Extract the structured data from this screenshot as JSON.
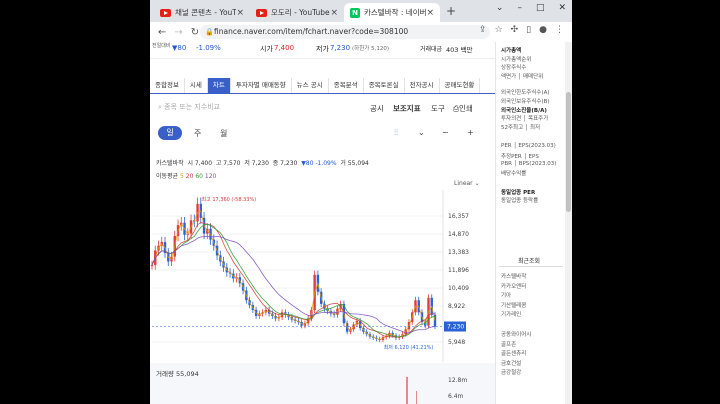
{
  "tabs": [
    {
      "title": "채널 콘텐츠 - YouTube",
      "icon": "youtube-icon"
    },
    {
      "title": "오도리 - YouTube",
      "icon": "youtube-icon"
    },
    {
      "title": "카스텔바작 : 네이버 증",
      "icon": "naver-icon"
    }
  ],
  "address": {
    "url": "finance.naver.com/item/fchart.naver?code=308100"
  },
  "price_row": {
    "prev_label": "전일대비",
    "change_amount": "▼80",
    "change_pct": "-1.09%",
    "high_label": "시가",
    "high_value": "7,400",
    "low_label": "저가",
    "low_value": "7,230",
    "low_note": "(하한가 5,120)",
    "amount_label": "거래대금",
    "amount_value": "403 백만"
  },
  "sub_tabs": [
    "종합정보",
    "시세",
    "차트",
    "투자자별 매매동향",
    "뉴스 공시",
    "종목분석",
    "종목토론실",
    "전자공시",
    "공매도현황"
  ],
  "active_sub_tab": "차트",
  "search": {
    "placeholder": "종목 또는 지수비교"
  },
  "chart_tools": {
    "notice": "공시",
    "indicator": "보조지표",
    "tool": "도구",
    "print": "인쇄"
  },
  "periods": [
    "일",
    "주",
    "월"
  ],
  "active_period": "일",
  "stock_info": {
    "name": "카스텔바작",
    "open": "시 7,400",
    "high": "고 7,570",
    "low": "저 7,230",
    "close": "종 7,230",
    "change": "▼80 -1.09%",
    "volume": "거 55,094"
  },
  "ma_label": "이동평균",
  "ma_values": [
    "5",
    "20",
    "60",
    "120"
  ],
  "scale_mode": "Linear",
  "chart_data": {
    "type": "line",
    "title": "",
    "y_ticks": [
      16357,
      14870,
      13383,
      11896,
      10409,
      8922,
      5948
    ],
    "current_price": 7230,
    "ylim": [
      4300,
      18500
    ],
    "annotations": [
      {
        "text": "최고 17,360 (-58.33%)",
        "value": 17360
      },
      {
        "text": "최저 6,120 (41.21%)",
        "value": 6120
      }
    ],
    "series": [
      {
        "name": "",
        "values": [
          12300,
          13500,
          13900,
          14200,
          13300,
          12600,
          13000,
          14700,
          15600,
          15800,
          14800,
          14900,
          16000,
          15900,
          17360,
          16200,
          14900,
          15300,
          14400,
          13900,
          13100,
          12600,
          12100,
          11700,
          11600,
          11200,
          11300,
          10800,
          10200,
          9400,
          9000,
          8600,
          8100,
          8300,
          8400,
          8600,
          8300,
          8100,
          7900,
          8000,
          8400,
          8200,
          8000,
          7800,
          7700,
          7600,
          7300,
          7500,
          7900,
          8600,
          11500,
          10100,
          9100,
          8700,
          8500,
          8300,
          8200,
          8700,
          9100,
          7500,
          6800,
          7000,
          7400,
          7700,
          7100,
          6800,
          6600,
          6400,
          6300,
          6200,
          6120,
          6350,
          6450,
          6700,
          6500,
          6300,
          6400,
          6600,
          7000,
          7600,
          8400,
          9400,
          8400,
          7600,
          7300,
          9600,
          8200,
          7230
        ]
      }
    ],
    "grid": true
  },
  "volume": {
    "label": "거래량",
    "value": "55,094",
    "y_ticks": [
      "12.8m",
      "6.4m"
    ]
  },
  "sidebar": {
    "items": [
      "시가총액",
      "시가총액순위",
      "상장주식수",
      "액면가 │ 매매단위",
      "외국인한도주식수(A)",
      "외국인보유주식수(B)",
      "외국인소진율(B/A)",
      "투자의견 │ 목표주가",
      "52주최고 │ 최저",
      "PER │ EPS(2023.03)",
      "추정PER │ EPS",
      "PBR │ BPS(2023.03)",
      "배당수익률",
      "동일업종 PER",
      "동일업종 등락률"
    ],
    "recent_label": "최근조회",
    "recent_items": [
      "카스텔바작",
      "카카오엔터",
      "기아",
      "기산텔레콤",
      "기가레인",
      "공동와이어시",
      "골프존",
      "골든센츄리",
      "금호건설",
      "금강철강"
    ]
  }
}
